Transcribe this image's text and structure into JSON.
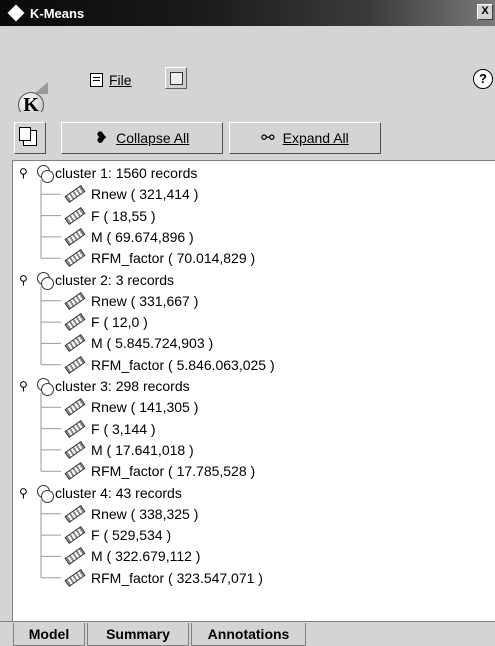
{
  "window": {
    "title": "K-Means",
    "close_label": "X"
  },
  "menu": {
    "file_label": "File",
    "help_label": "?"
  },
  "logo_text": "K",
  "toolbar": {
    "collapse_label": "Collapse All",
    "expand_label": "Expand All"
  },
  "clusters": [
    {
      "label": "cluster 1: 1560 records",
      "fields": [
        "Rnew ( 321,414 )",
        "F ( 18,55 )",
        "M ( 69.674,896 )",
        "RFM_factor ( 70.014,829 )"
      ]
    },
    {
      "label": "cluster 2: 3 records",
      "fields": [
        "Rnew ( 331,667 )",
        "F ( 12,0 )",
        "M ( 5.845.724,903 )",
        "RFM_factor ( 5.846.063,025 )"
      ]
    },
    {
      "label": "cluster 3: 298 records",
      "fields": [
        "Rnew ( 141,305 )",
        "F ( 3,144 )",
        "M ( 17.641,018 )",
        "RFM_factor ( 17.785,528 )"
      ]
    },
    {
      "label": "cluster 4: 43 records",
      "fields": [
        "Rnew ( 338,325 )",
        "F ( 529,534 )",
        "M ( 322.679,112 )",
        "RFM_factor ( 323.547,071 )"
      ]
    }
  ],
  "tabs": [
    {
      "label": "Model",
      "active": true
    },
    {
      "label": "Summary",
      "active": false
    },
    {
      "label": "Annotations",
      "active": false
    }
  ]
}
